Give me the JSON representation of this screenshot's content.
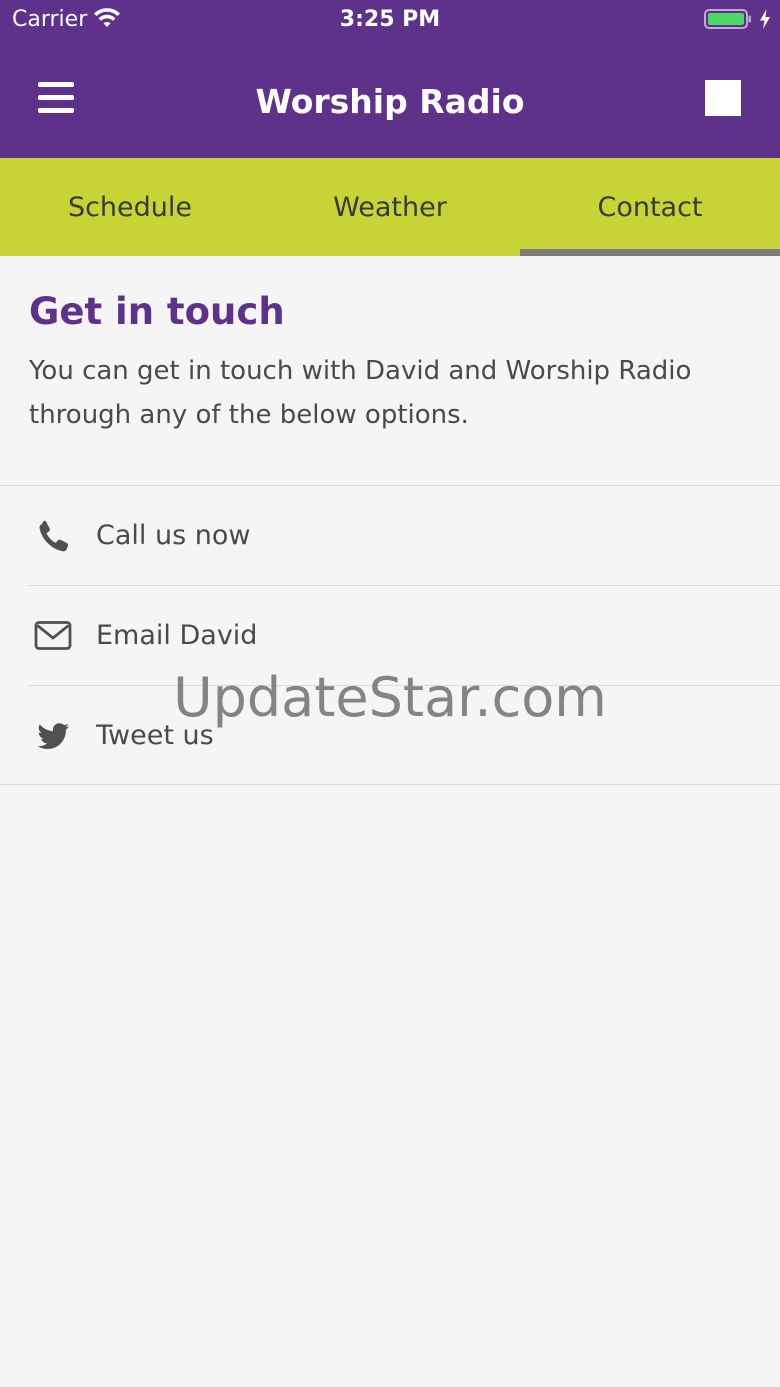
{
  "status_bar": {
    "carrier": "Carrier",
    "time": "3:25 PM",
    "wifi_icon": "wifi-icon",
    "battery_icon": "battery-charging-icon",
    "battery_color": "#4cd964"
  },
  "header": {
    "title": "Worship Radio",
    "menu_icon": "hamburger-menu-icon",
    "right_icon": "stop-square-icon",
    "background_color": "#5e318a"
  },
  "tabs": {
    "background_color": "#c8d435",
    "active_index": 2,
    "items": [
      {
        "label": "Schedule"
      },
      {
        "label": "Weather"
      },
      {
        "label": "Contact"
      }
    ]
  },
  "contact": {
    "heading": "Get in touch",
    "heading_color": "#5e318a",
    "intro": "You can get in touch with David and Worship Radio through any of the below options.",
    "options": [
      {
        "label": "Call us now",
        "icon": "phone-icon"
      },
      {
        "label": "Email David",
        "icon": "envelope-icon"
      },
      {
        "label": "Tweet us",
        "icon": "twitter-bird-icon"
      }
    ]
  },
  "watermark": "UpdateStar.com"
}
